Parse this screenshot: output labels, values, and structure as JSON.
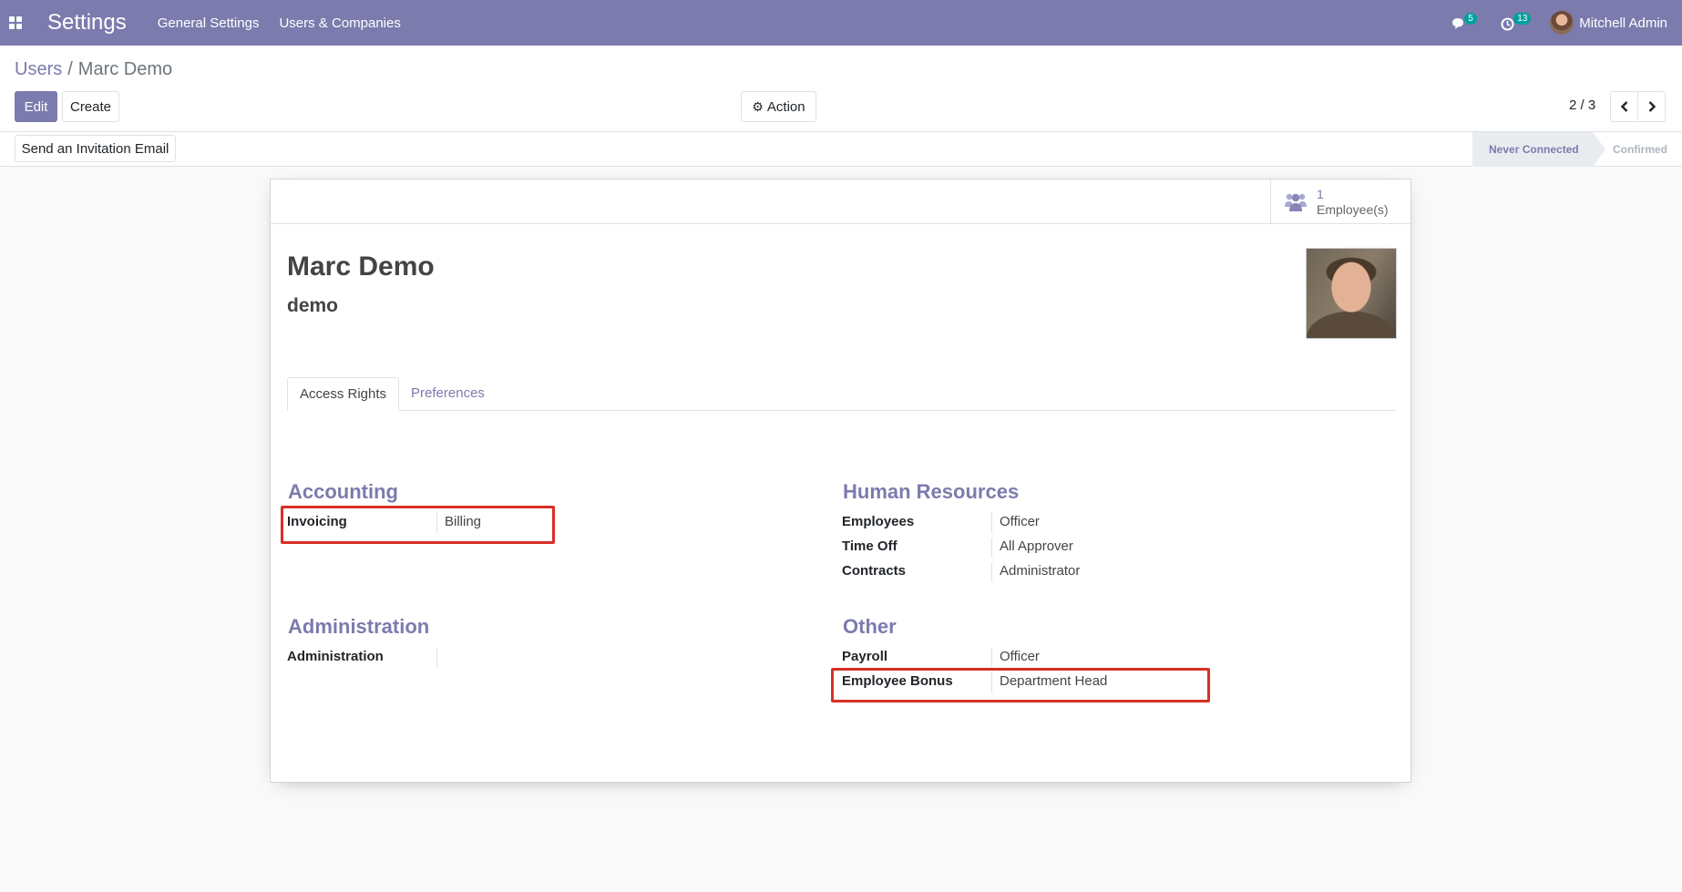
{
  "navbar": {
    "brand": "Settings",
    "menu": [
      "General Settings",
      "Users & Companies"
    ],
    "messages_count": "5",
    "activities_count": "13",
    "user_name": "Mitchell Admin"
  },
  "breadcrumb": {
    "parent": "Users",
    "current": "Marc Demo"
  },
  "toolbar": {
    "edit_label": "Edit",
    "create_label": "Create",
    "action_label": "Action",
    "pager": "2 / 3"
  },
  "statusbar": {
    "invite_label": "Send an Invitation Email",
    "stages": [
      "Never Connected",
      "Confirmed"
    ],
    "active_stage": "Never Connected"
  },
  "form": {
    "stat_button": {
      "value": "1",
      "label": "Employee(s)"
    },
    "name": "Marc Demo",
    "login": "demo",
    "tabs": [
      "Access Rights",
      "Preferences"
    ],
    "groups": {
      "accounting": {
        "title": "Accounting",
        "fields": [
          {
            "label": "Invoicing",
            "value": "Billing"
          }
        ]
      },
      "administration": {
        "title": "Administration",
        "fields": [
          {
            "label": "Administration",
            "value": ""
          }
        ]
      },
      "human_resources": {
        "title": "Human Resources",
        "fields": [
          {
            "label": "Employees",
            "value": "Officer"
          },
          {
            "label": "Time Off",
            "value": "All Approver"
          },
          {
            "label": "Contracts",
            "value": "Administrator"
          }
        ]
      },
      "other": {
        "title": "Other",
        "fields": [
          {
            "label": "Payroll",
            "value": "Officer"
          },
          {
            "label": "Employee Bonus",
            "value": "Department Head"
          }
        ]
      }
    }
  },
  "colors": {
    "brand": "#7c7bad",
    "highlight": "#d92f26",
    "badge": "#00a09d"
  },
  "icons": [
    "apps-icon",
    "chat-icon",
    "clock-icon",
    "gear-icon",
    "chevron-left-icon",
    "chevron-right-icon",
    "users-icon"
  ]
}
